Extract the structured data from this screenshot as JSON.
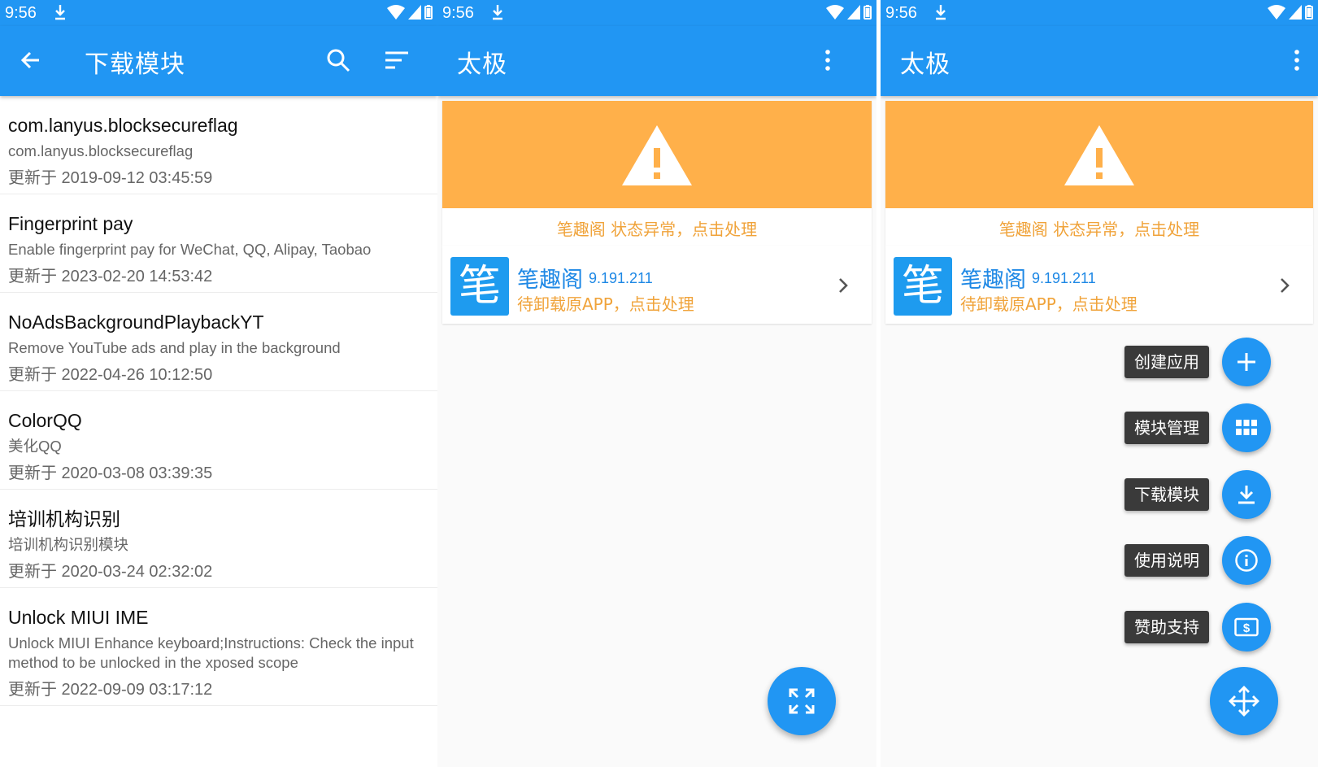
{
  "panels": [
    {
      "status": {
        "time": "9:56"
      },
      "appbar": {
        "title": "下载模块"
      },
      "modules": [
        {
          "name": "com.lanyus.blocksecureflag",
          "desc": "com.lanyus.blocksecureflag",
          "updated": "更新于 2019-09-12 03:45:59"
        },
        {
          "name": "Fingerprint pay",
          "desc": "Enable fingerprint pay for WeChat, QQ, Alipay, Taobao",
          "updated": "更新于 2023-02-20 14:53:42"
        },
        {
          "name": "NoAdsBackgroundPlaybackYT",
          "desc": "Remove YouTube ads and play in the background",
          "updated": "更新于 2022-04-26 10:12:50"
        },
        {
          "name": "ColorQQ",
          "desc": "美化QQ",
          "updated": "更新于 2020-03-08 03:39:35"
        },
        {
          "name": "培训机构识别",
          "desc": "培训机构识别模块",
          "updated": "更新于 2020-03-24 02:32:02"
        },
        {
          "name": "Unlock MIUI IME",
          "desc": "Unlock MIUI Enhance keyboard;Instructions: Check the input method to be unlocked in the xposed scope",
          "updated": "更新于 2022-09-09 03:17:12"
        }
      ]
    },
    {
      "status": {
        "time": "9:56"
      },
      "appbar": {
        "title": "太极"
      },
      "warning": "笔趣阁 状态异常，点击处理",
      "app": {
        "logo": "笔",
        "name": "笔趣阁",
        "version": "9.191.211",
        "sub": "待卸载原APP，点击处理"
      }
    },
    {
      "status": {
        "time": "9:56"
      },
      "appbar": {
        "title": "太极"
      },
      "warning": "笔趣阁 状态异常，点击处理",
      "app": {
        "logo": "笔",
        "name": "笔趣阁",
        "version": "9.191.211",
        "sub": "待卸载原APP，点击处理"
      },
      "fab_menu": [
        {
          "label": "创建应用",
          "icon": "plus-icon"
        },
        {
          "label": "模块管理",
          "icon": "grid-icon"
        },
        {
          "label": "下载模块",
          "icon": "download-icon"
        },
        {
          "label": "使用说明",
          "icon": "info-icon"
        },
        {
          "label": "赞助支持",
          "icon": "dollar-icon"
        }
      ]
    }
  ],
  "colors": {
    "primary": "#2196f3",
    "warning": "#ffb04a",
    "warning_text": "#f0a33a",
    "chip": "#3a3a3a"
  }
}
